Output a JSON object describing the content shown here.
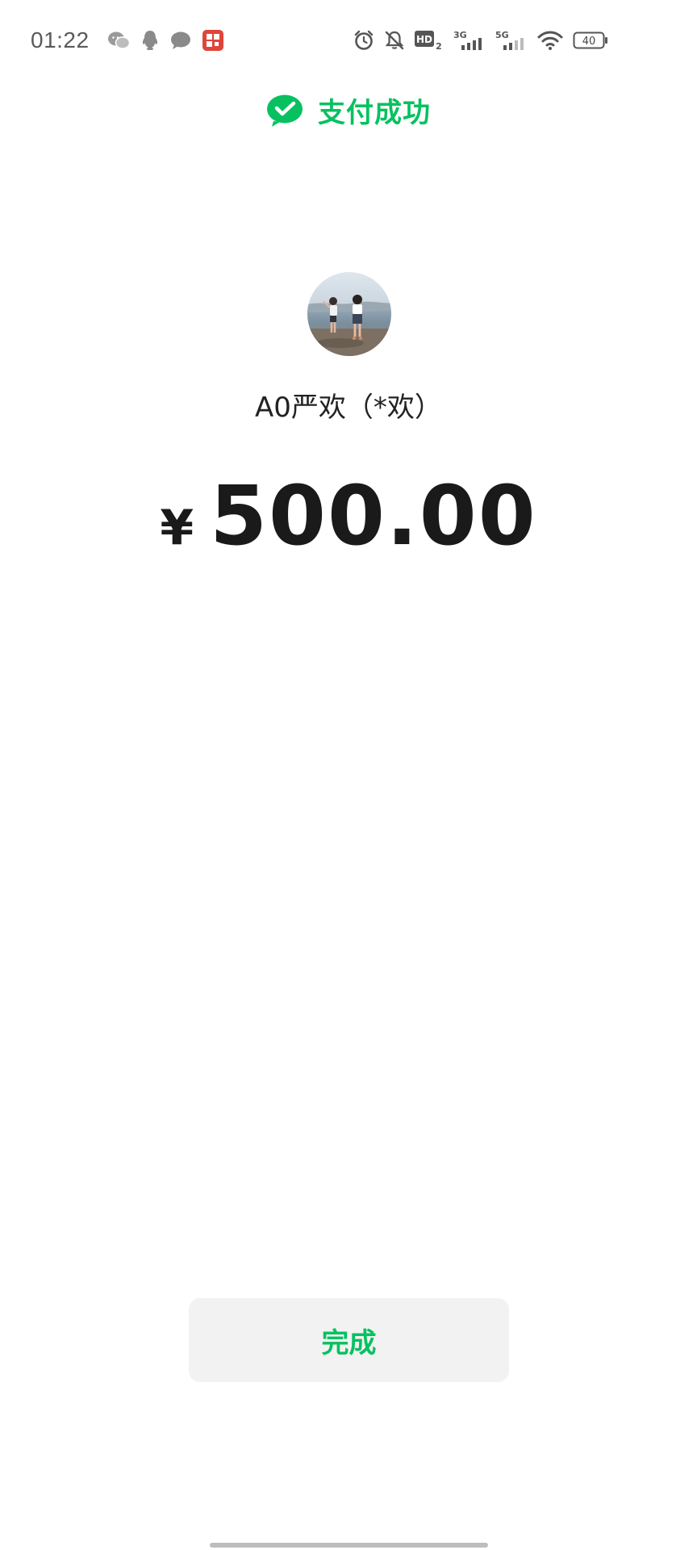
{
  "status_bar": {
    "time": "01:22",
    "battery_level": "40",
    "network_labels": [
      "HD",
      "2",
      "3G",
      "5G"
    ],
    "left_icons": [
      "wechat-icon",
      "qq-icon",
      "message-icon",
      "red-app-icon"
    ],
    "right_icons": [
      "alarm-icon",
      "mute-icon",
      "hd-icon",
      "signal-3g-icon",
      "signal-5g-icon",
      "wifi-icon",
      "battery-icon"
    ]
  },
  "header": {
    "title": "支付成功",
    "icon": "wechat-pay-check-icon"
  },
  "payee": {
    "name": "A0严欢（*欢）"
  },
  "payment": {
    "currency_symbol": "¥",
    "amount": "500.00"
  },
  "actions": {
    "done_label": "完成"
  },
  "colors": {
    "brand_green": "#07c160",
    "text_primary": "#1a1a1a",
    "button_bg": "#f2f2f2"
  }
}
